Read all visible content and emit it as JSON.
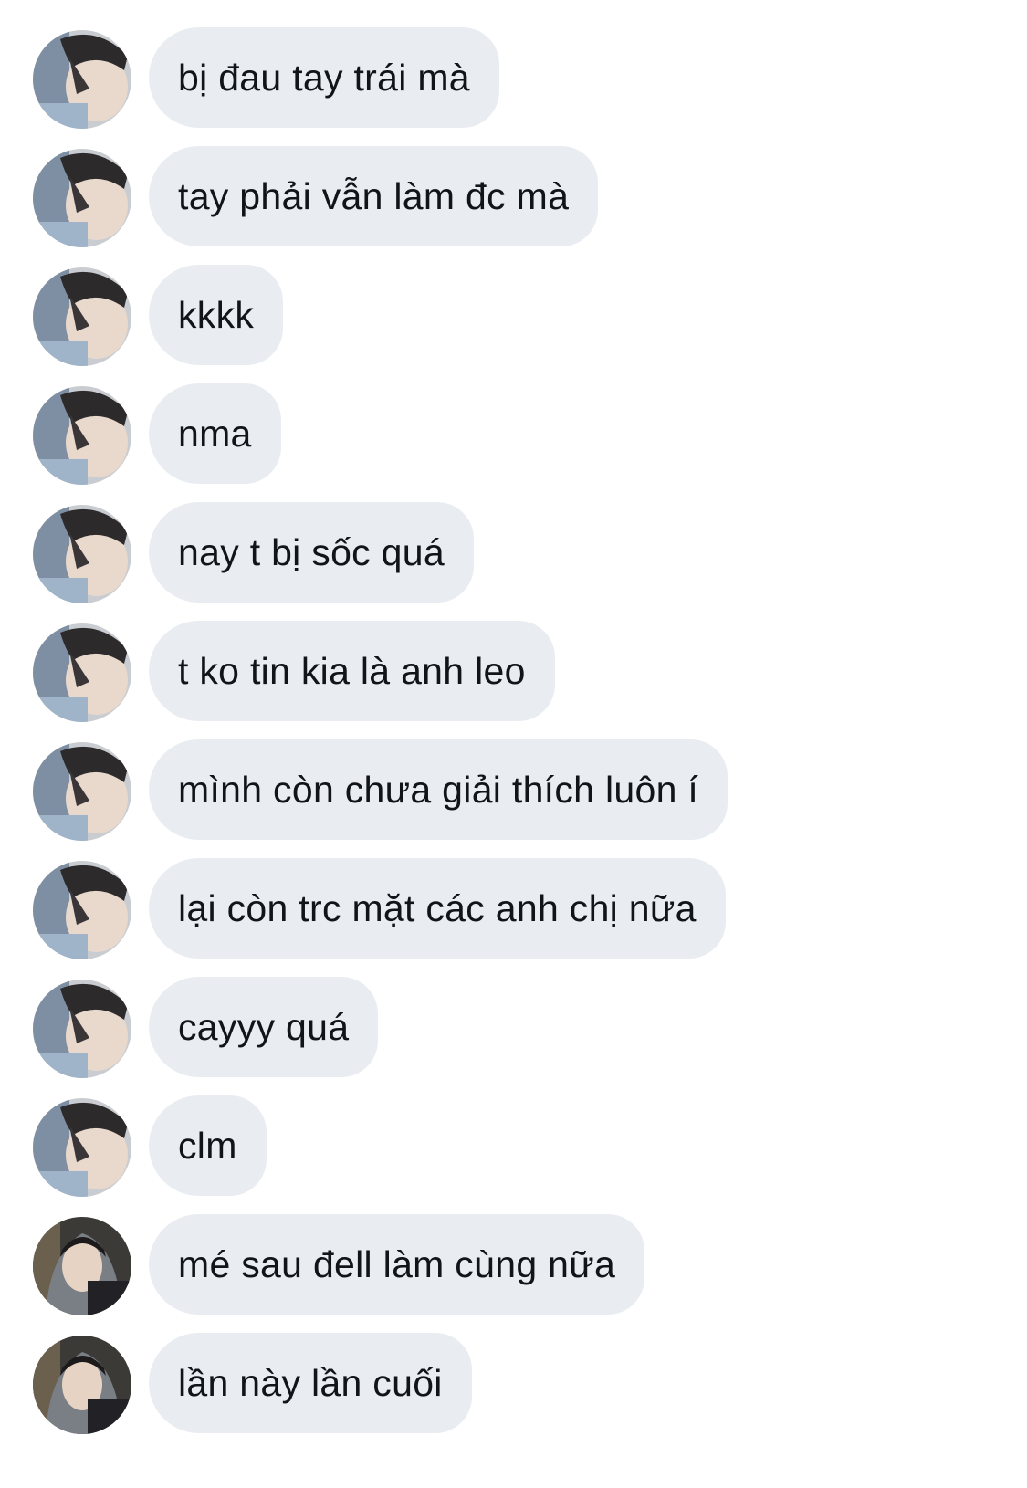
{
  "messages": [
    {
      "text": "bị đau tay trái mà",
      "sender_avatar": "avatar-light"
    },
    {
      "text": "tay phải vẫn làm đc mà",
      "sender_avatar": "avatar-light"
    },
    {
      "text": "kkkk",
      "sender_avatar": "avatar-light"
    },
    {
      "text": "nma",
      "sender_avatar": "avatar-light"
    },
    {
      "text": "nay t bị sốc quá",
      "sender_avatar": "avatar-light"
    },
    {
      "text": "t ko tin kia là anh leo",
      "sender_avatar": "avatar-light"
    },
    {
      "text": "mình còn chưa giải thích luôn í",
      "sender_avatar": "avatar-light"
    },
    {
      "text": "lại còn trc mặt các anh chị nữa",
      "sender_avatar": "avatar-light"
    },
    {
      "text": "cayyy quá",
      "sender_avatar": "avatar-light"
    },
    {
      "text": "clm",
      "sender_avatar": "avatar-light"
    },
    {
      "text": "mé sau đell làm cùng nữa",
      "sender_avatar": "avatar-dark"
    },
    {
      "text": "lần này lần cuối",
      "sender_avatar": "avatar-dark"
    }
  ],
  "colors": {
    "background": "#ffffff",
    "bubble": "#e9edf2",
    "text": "#111418"
  }
}
